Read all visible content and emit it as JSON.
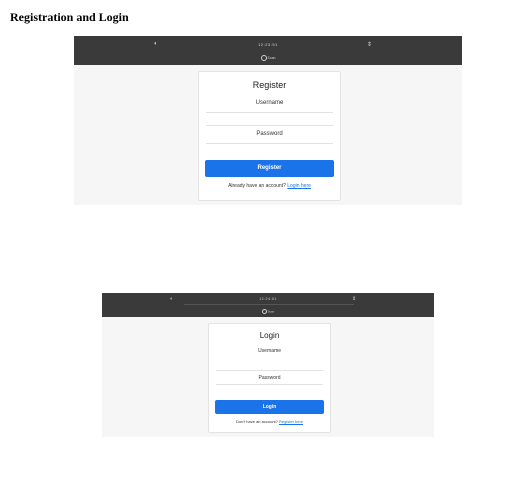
{
  "page_title": "Registration and Login",
  "register_screen": {
    "topbar": {
      "time": "12:23:51",
      "sub_label": "Scan",
      "left_icon": "contrast-icon",
      "right_icon": "chevron-updown-icon"
    },
    "title": "Register",
    "username_label": "Username",
    "password_label": "Password",
    "button_label": "Register",
    "footer_text": "Already have an account?",
    "footer_link": "Login here"
  },
  "login_screen": {
    "topbar": {
      "time": "12:24:01",
      "sub_label": "Scan",
      "left_icon": "contrast-icon",
      "right_icon": "chevron-updown-icon"
    },
    "title": "Login",
    "username_label": "Username",
    "password_label": "Password",
    "button_label": "Login",
    "footer_text": "Don't have an account?",
    "footer_link": "Register here"
  },
  "colors": {
    "topbar": "#3a3a3a",
    "background": "#f6f6f6",
    "button": "#1a73e8"
  }
}
